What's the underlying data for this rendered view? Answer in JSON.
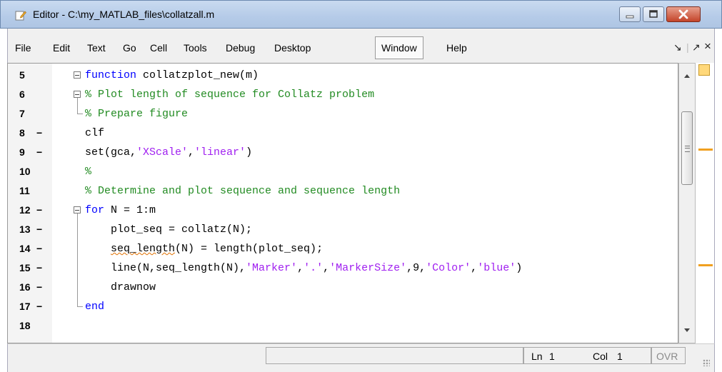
{
  "window": {
    "title": "Editor - C:\\my_MATLAB_files\\collatzall.m"
  },
  "menu": [
    "File",
    "Edit",
    "Text",
    "Go",
    "Cell",
    "Tools",
    "Debug",
    "Desktop",
    "Window",
    "Help"
  ],
  "menu_right": {
    "undock": "↘",
    "restore": "↗",
    "close": "×"
  },
  "code": [
    {
      "num": "5",
      "dash": "",
      "tokens": [
        {
          "t": "function",
          "c": "kw"
        },
        {
          "t": " collatzplot_new(m)",
          "c": ""
        }
      ]
    },
    {
      "num": "6",
      "dash": "",
      "tokens": [
        {
          "t": "% Plot length of sequence for Collatz problem",
          "c": "cm"
        }
      ]
    },
    {
      "num": "7",
      "dash": "",
      "tokens": [
        {
          "t": "% Prepare figure",
          "c": "cm"
        }
      ]
    },
    {
      "num": "8",
      "dash": "−",
      "tokens": [
        {
          "t": "clf",
          "c": ""
        }
      ]
    },
    {
      "num": "9",
      "dash": "−",
      "tokens": [
        {
          "t": "set(gca,",
          "c": ""
        },
        {
          "t": "'XScale'",
          "c": "st"
        },
        {
          "t": ",",
          "c": ""
        },
        {
          "t": "'linear'",
          "c": "st"
        },
        {
          "t": ")",
          "c": ""
        }
      ]
    },
    {
      "num": "10",
      "dash": "",
      "tokens": [
        {
          "t": "%",
          "c": "cm"
        }
      ]
    },
    {
      "num": "11",
      "dash": "",
      "tokens": [
        {
          "t": "% Determine and plot sequence and sequence length",
          "c": "cm"
        }
      ]
    },
    {
      "num": "12",
      "dash": "−",
      "tokens": [
        {
          "t": "for",
          "c": "kw"
        },
        {
          "t": " N = 1:m",
          "c": ""
        }
      ]
    },
    {
      "num": "13",
      "dash": "−",
      "tokens": [
        {
          "t": "    plot_seq = collatz(N);",
          "c": ""
        }
      ]
    },
    {
      "num": "14",
      "dash": "−",
      "tokens": [
        {
          "t": "    ",
          "c": ""
        },
        {
          "t": "seq_length",
          "c": "squig"
        },
        {
          "t": "(N) = length(plot_seq);",
          "c": ""
        }
      ]
    },
    {
      "num": "15",
      "dash": "−",
      "tokens": [
        {
          "t": "    line(N,seq_length(N),",
          "c": ""
        },
        {
          "t": "'Marker'",
          "c": "st"
        },
        {
          "t": ",",
          "c": ""
        },
        {
          "t": "'.'",
          "c": "st"
        },
        {
          "t": ",",
          "c": ""
        },
        {
          "t": "'MarkerSize'",
          "c": "st"
        },
        {
          "t": ",9,",
          "c": ""
        },
        {
          "t": "'Color'",
          "c": "st"
        },
        {
          "t": ",",
          "c": ""
        },
        {
          "t": "'blue'",
          "c": "st"
        },
        {
          "t": ")",
          "c": ""
        }
      ]
    },
    {
      "num": "16",
      "dash": "−",
      "tokens": [
        {
          "t": "    drawnow",
          "c": ""
        }
      ]
    },
    {
      "num": "17",
      "dash": "−",
      "tokens": [
        {
          "t": "end",
          "c": "kw"
        }
      ]
    },
    {
      "num": "18",
      "dash": "",
      "tokens": []
    }
  ],
  "status": {
    "ln_label": "Ln",
    "ln_value": "1",
    "col_label": "Col",
    "col_value": "1",
    "ovr": "OVR"
  },
  "colors": {
    "keyword": "#0000ff",
    "comment": "#228b22",
    "string": "#a020f0",
    "warning": "#f0a020"
  }
}
